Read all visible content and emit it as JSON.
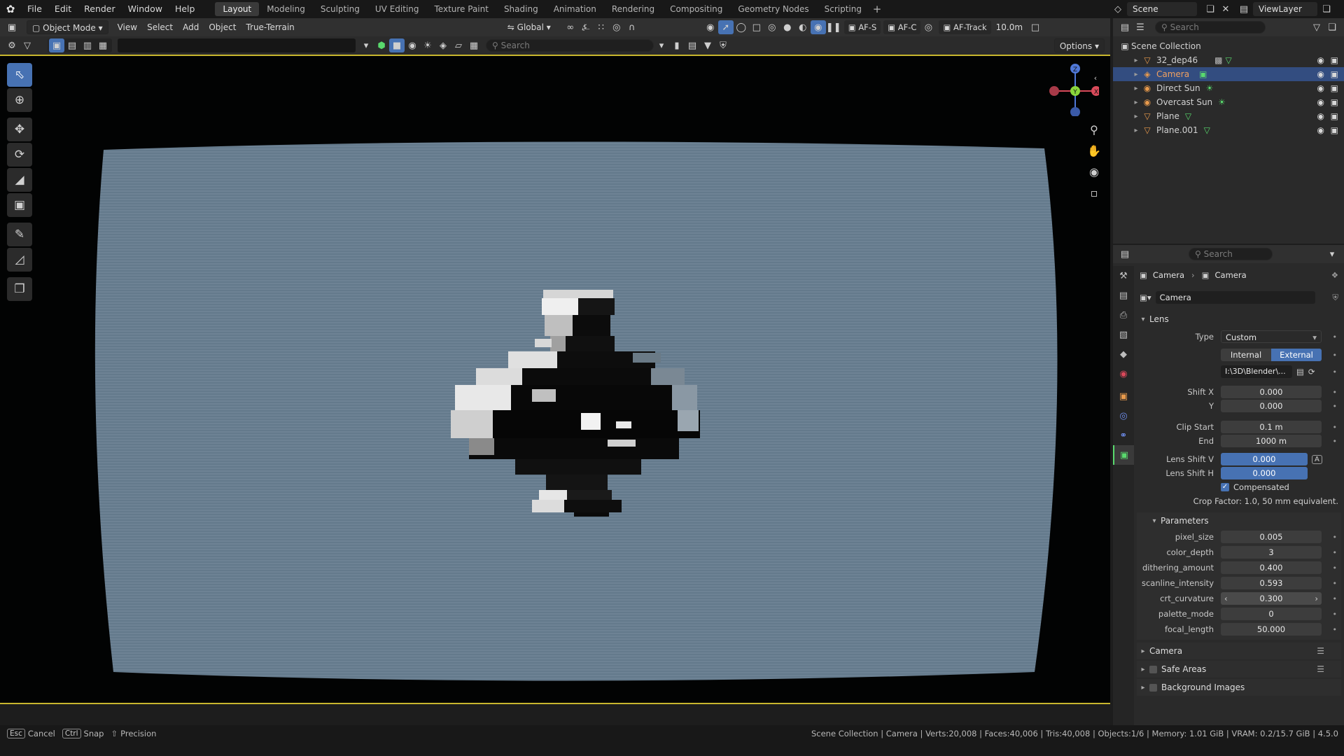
{
  "menu": [
    "File",
    "Edit",
    "Render",
    "Window",
    "Help"
  ],
  "workspaces": [
    "Layout",
    "Modeling",
    "Sculpting",
    "UV Editing",
    "Texture Paint",
    "Shading",
    "Animation",
    "Rendering",
    "Compositing",
    "Geometry Nodes",
    "Scripting"
  ],
  "active_workspace": "Layout",
  "scene_name": "Scene",
  "view_layer": "ViewLayer",
  "header": {
    "mode": "Object Mode",
    "view_menu": [
      "View",
      "Select",
      "Add",
      "Object",
      "True-Terrain"
    ],
    "orientation": "Global",
    "af_s": "AF-S",
    "af_c": "AF-C",
    "af_track": "AF-Track",
    "distance": "10.0m"
  },
  "toolbar": {
    "search_placeholder": "Search",
    "options": "Options"
  },
  "outliner": {
    "search_placeholder": "Search",
    "collection": "Scene Collection",
    "items": [
      {
        "name": "32_dep46",
        "selected": false
      },
      {
        "name": "Camera",
        "selected": true
      },
      {
        "name": "Direct Sun",
        "selected": false
      },
      {
        "name": "Overcast Sun",
        "selected": false
      },
      {
        "name": "Plane",
        "selected": false
      },
      {
        "name": "Plane.001",
        "selected": false
      }
    ]
  },
  "properties": {
    "search_placeholder": "Search",
    "breadcrumb": [
      "Camera",
      "Camera"
    ],
    "datablock": "Camera",
    "lens": {
      "title": "Lens",
      "type_label": "Type",
      "type_value": "Custom",
      "internal": "Internal",
      "external": "External",
      "path": "I:\\3D\\Blender\\...",
      "shift_x_label": "Shift X",
      "shift_x": "0.000",
      "shift_y_label": "Y",
      "shift_y": "0.000",
      "clip_start_label": "Clip Start",
      "clip_start": "0.1 m",
      "clip_end_label": "End",
      "clip_end": "1000 m",
      "lens_shift_v_label": "Lens Shift V",
      "lens_shift_v": "0.000",
      "lens_shift_h_label": "Lens Shift H",
      "lens_shift_h": "0.000",
      "compensated": "Compensated",
      "crop_factor": "Crop Factor: 1.0, 50 mm equivalent."
    },
    "parameters": {
      "title": "Parameters",
      "rows": [
        {
          "label": "pixel_size",
          "value": "0.005"
        },
        {
          "label": "color_depth",
          "value": "3"
        },
        {
          "label": "dithering_amount",
          "value": "0.400"
        },
        {
          "label": "scanline_intensity",
          "value": "0.593"
        },
        {
          "label": "crt_curvature",
          "value": "0.300"
        },
        {
          "label": "palette_mode",
          "value": "0"
        },
        {
          "label": "focal_length",
          "value": "50.000"
        }
      ]
    },
    "collapsed_panels": [
      "Camera",
      "Safe Areas",
      "Background Images"
    ]
  },
  "status": {
    "cancel_key": "Esc",
    "cancel": "Cancel",
    "snap_key": "Ctrl",
    "snap": "Snap",
    "precision": "Precision",
    "info": "Scene Collection | Camera | Verts:20,008 | Faces:40,006 | Tris:40,008 | Objects:1/6 | Memory: 1.01 GiB | VRAM: 0.2/15.7 GiB | 4.5.0"
  },
  "colors": {
    "accent": "#4772b3",
    "viewport_border": "#c8b62e",
    "screen_fill": "#6d8294",
    "object_orange": "#e89a4c",
    "data_green": "#59d96d"
  }
}
